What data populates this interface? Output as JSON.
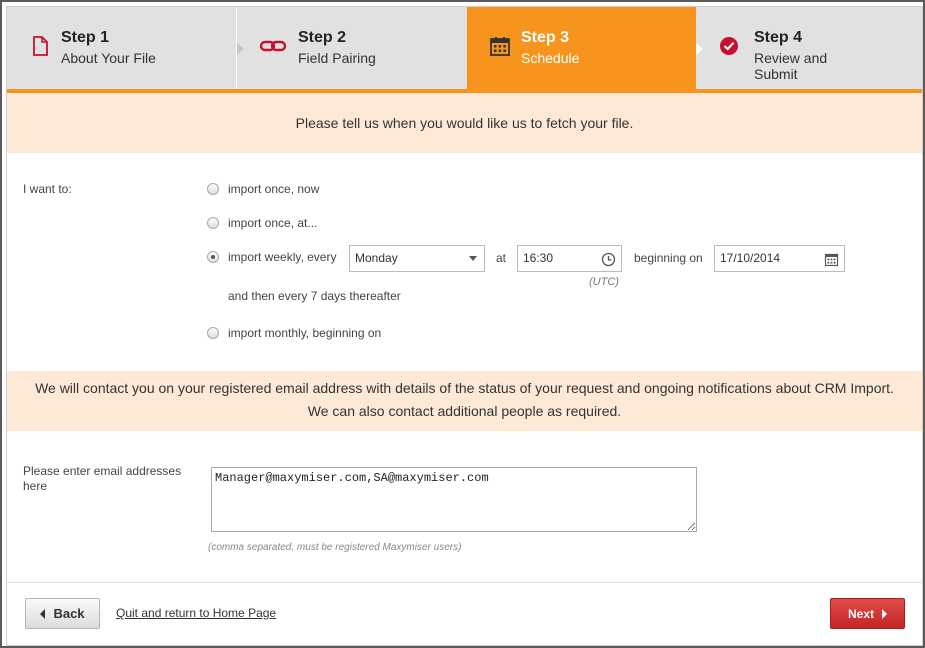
{
  "colors": {
    "accent": "#f7941d",
    "banner_bg": "#fde9d6",
    "icon_red": "#c8102e",
    "next_button": "#d73333"
  },
  "steps": [
    {
      "number": "Step 1",
      "label": "About Your File",
      "icon": "document-icon",
      "state": "done"
    },
    {
      "number": "Step 2",
      "label": "Field Pairing",
      "icon": "link-icon",
      "state": "done"
    },
    {
      "number": "Step 3",
      "label": "Schedule",
      "icon": "calendar-icon",
      "state": "active"
    },
    {
      "number": "Step 4",
      "label": "Review and Submit",
      "icon": "check-circle-icon",
      "state": "todo"
    }
  ],
  "banner_fetch": "Please tell us when you would like us to fetch your file.",
  "schedule": {
    "label": "I want to:",
    "options": [
      {
        "label": "import once, now",
        "checked": false
      },
      {
        "label": "import once, at...",
        "checked": false
      },
      {
        "label": "import weekly, every",
        "checked": true
      },
      {
        "label": "import monthly, beginning on",
        "checked": false
      }
    ],
    "weekday": "Monday",
    "at_label": "at",
    "time": "16:30",
    "timezone": "(UTC)",
    "beginning_label": "beginning on",
    "start_date": "17/10/2014",
    "repeat_text": "and then every 7 days thereafter"
  },
  "contact_banner": {
    "line1": "We will contact you on your registered email address with details of the status of your request and ongoing notifications about CRM Import.",
    "line2": "We can also contact additional people as required."
  },
  "email": {
    "label": "Please enter email addresses here",
    "value": "Manager@maxymiser.com,SA@maxymiser.com",
    "hint": "(comma separated, must be registered Maxymiser users)"
  },
  "footer": {
    "back_label": "Back",
    "quit_label": "Quit and return to Home Page",
    "next_label": "Next"
  }
}
